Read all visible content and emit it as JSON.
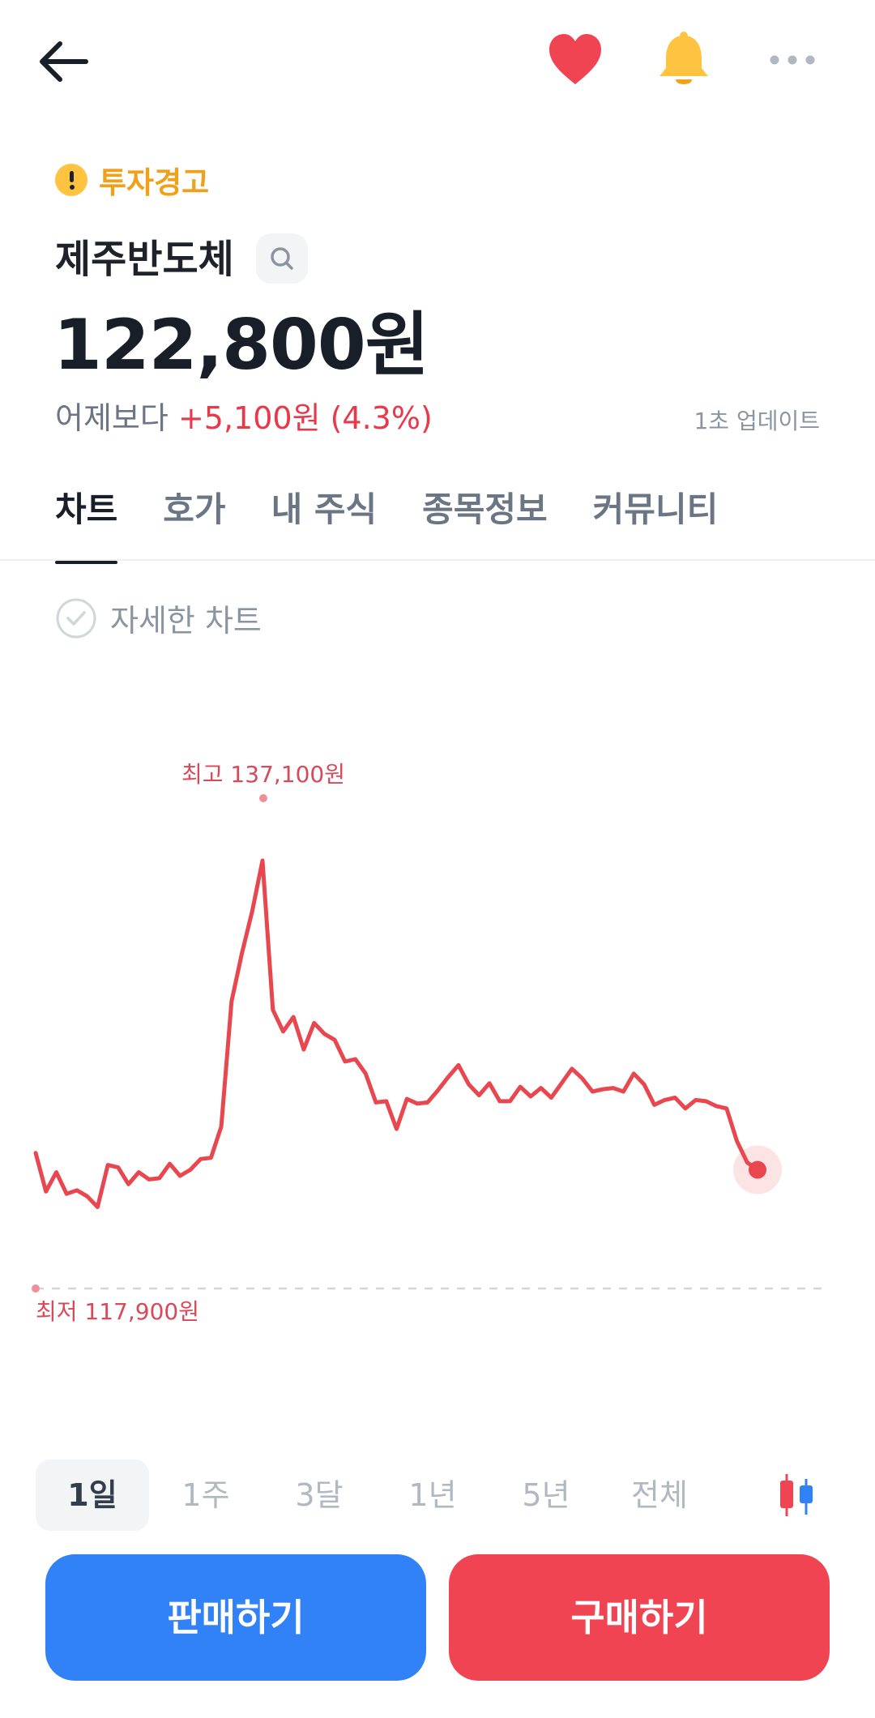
{
  "header": {
    "back_icon": "arrow-left-icon",
    "favorite_icon": "heart-icon",
    "alert_icon": "bell-icon",
    "more_icon": "more-horizontal-icon"
  },
  "warning": {
    "label": "투자경고",
    "color": "#f0a019"
  },
  "stock": {
    "name": "제주반도체",
    "price": "122,800원",
    "change_prefix": "어제보다",
    "change_value": "+5,100원 (4.3%)",
    "update_text": "1초 업데이트"
  },
  "tabs": [
    {
      "label": "차트",
      "active": true
    },
    {
      "label": "호가",
      "active": false
    },
    {
      "label": "내 주식",
      "active": false
    },
    {
      "label": "종목정보",
      "active": false
    },
    {
      "label": "커뮤니티",
      "active": false
    }
  ],
  "detail_chart": {
    "label": "자세한 차트",
    "checked": false
  },
  "chart_data": {
    "type": "line",
    "color": "#e8474f",
    "high_label": "최고 137,100원",
    "low_label": "최저 117,900원",
    "high": 137100,
    "low": 117900,
    "last": 122800,
    "values": [
      123500,
      121900,
      122700,
      121800,
      121950,
      121700,
      121250,
      123000,
      122900,
      122200,
      122700,
      122400,
      122450,
      123050,
      122550,
      122800,
      123250,
      123300,
      124600,
      129800,
      131800,
      133550,
      135650,
      129450,
      128550,
      129150,
      127800,
      128900,
      128450,
      128200,
      127300,
      127400,
      126800,
      125600,
      125650,
      124500,
      125750,
      125550,
      125600,
      126100,
      126650,
      127150,
      126350,
      125900,
      126400,
      125650,
      125650,
      126250,
      125850,
      126200,
      125800,
      126400,
      127000,
      126600,
      126050,
      126150,
      126200,
      126050,
      126800,
      126350,
      125500,
      125700,
      125800,
      125350,
      125700,
      125650,
      125450,
      125350,
      124000,
      123100,
      122800
    ]
  },
  "periods": [
    {
      "label": "1일",
      "active": true
    },
    {
      "label": "1주",
      "active": false
    },
    {
      "label": "3달",
      "active": false
    },
    {
      "label": "1년",
      "active": false
    },
    {
      "label": "5년",
      "active": false
    },
    {
      "label": "전체",
      "active": false
    }
  ],
  "candle_icon": "candlestick-icon",
  "actions": {
    "sell_label": "판매하기",
    "buy_label": "구매하기",
    "sell_color": "#3182f6",
    "buy_color": "#f04452"
  }
}
